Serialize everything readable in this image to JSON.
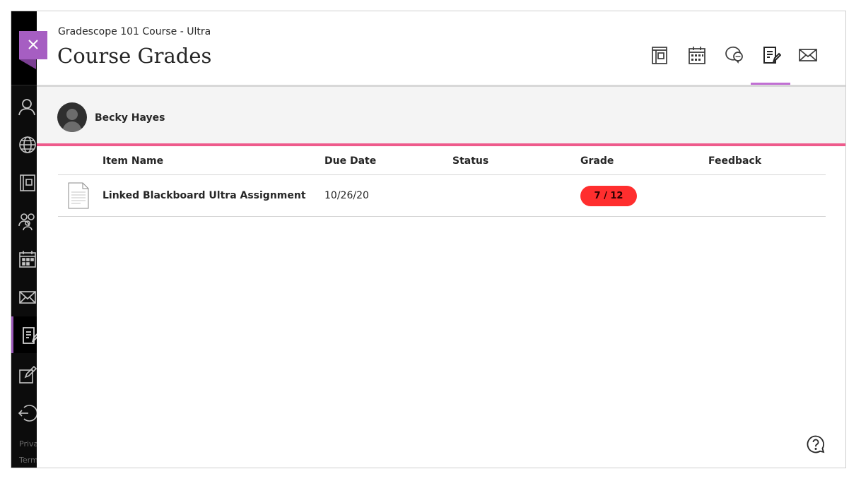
{
  "header": {
    "course_name": "Gradescope 101 Course - Ultra",
    "page_title": "Course Grades"
  },
  "toolbar": {
    "icons": [
      "course-content-icon",
      "calendar-icon",
      "discussions-icon",
      "grades-icon",
      "messages-icon"
    ],
    "active": "grades-icon"
  },
  "sidebar": {
    "icons": [
      "person-icon",
      "globe-icon",
      "book-icon",
      "people-icon",
      "calendar-icon",
      "mail-icon",
      "grades-icon",
      "edit-icon",
      "sign-out-icon"
    ],
    "footer": [
      "Privacy",
      "Terms"
    ]
  },
  "student": {
    "name": "Becky Hayes"
  },
  "table": {
    "headers": [
      "Item Name",
      "Due Date",
      "Status",
      "Grade",
      "Feedback"
    ],
    "rows": [
      {
        "icon": "document-icon",
        "name": "Linked Blackboard Ultra Assignment",
        "due": "10/26/20",
        "status": "",
        "grade": "7 / 12",
        "feedback": ""
      }
    ]
  },
  "colors": {
    "accent_purple": "#a65ec2",
    "pink_rule": "#ee5a8b",
    "grade_badge": "#ff2e2e",
    "rail": "#0c0c0c"
  }
}
